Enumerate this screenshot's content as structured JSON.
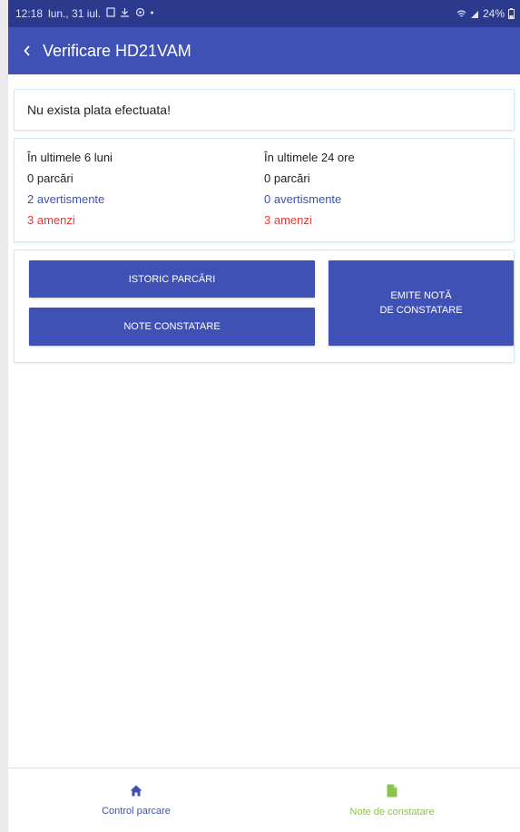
{
  "statusbar": {
    "time": "12:18",
    "date": "lun., 31 iul.",
    "battery": "24%"
  },
  "appbar": {
    "title": "Verificare HD21VAM"
  },
  "payment": {
    "message": "Nu exista plata efectuata!"
  },
  "stats": {
    "left": {
      "heading": "În ultimele 6 luni",
      "parkings": "0 parcări",
      "warnings": "2 avertismente",
      "fines": "3 amenzi"
    },
    "right": {
      "heading": "În ultimele 24 ore",
      "parkings": "0 parcări",
      "warnings": "0 avertismente",
      "fines": "3 amenzi"
    }
  },
  "actions": {
    "history": "ISTORIC PARCĂRI",
    "notes": "NOTE CONSTATARE",
    "emit_line1": "EMITE NOTĂ",
    "emit_line2": "DE CONSTATARE"
  },
  "bottom_nav": [
    {
      "label": "Control parcare",
      "icon": "home-icon",
      "color": "#3f51b5"
    },
    {
      "label": "Note de constatare",
      "icon": "document-icon",
      "color": "#8bc34a"
    }
  ],
  "colors": {
    "primary": "#3f51b5",
    "statusbar": "#2c3a8e",
    "warning_blue": "#3f51b5",
    "fine_red": "#e53935",
    "accent_green": "#8bc34a"
  }
}
